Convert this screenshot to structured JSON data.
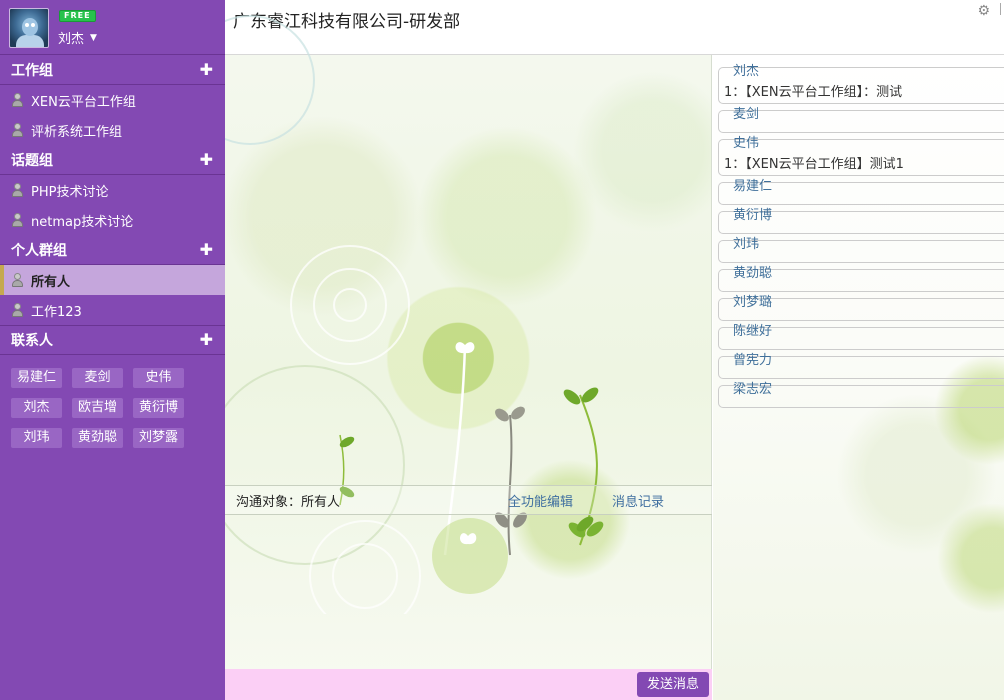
{
  "user": {
    "name": "刘杰",
    "badge": "FREE"
  },
  "groups": [
    {
      "title": "工作组",
      "items": [
        "XEN云平台工作组",
        "评析系统工作组"
      ]
    },
    {
      "title": "话题组",
      "items": [
        "PHP技术讨论",
        "netmap技术讨论"
      ]
    },
    {
      "title": "个人群组",
      "items": [
        "所有人",
        "工作123"
      ],
      "active_index": 0
    }
  ],
  "contacts": {
    "title": "联系人",
    "names": [
      "易建仁",
      "麦剑",
      "史伟",
      "刘杰",
      "欧吉增",
      "黄衍博",
      "刘玮",
      "黄劲聪",
      "刘梦露"
    ]
  },
  "header": {
    "title": "广东睿江科技有限公司-研发部"
  },
  "chat": {
    "target_label": "沟通对象：所有人",
    "full_edit": "全功能编辑",
    "history": "消息记录",
    "send_button": "发送消息"
  },
  "members": [
    {
      "name": "刘杰",
      "messages": [
        "1：【XEN云平台工作组】：测试"
      ]
    },
    {
      "name": "麦剑",
      "messages": []
    },
    {
      "name": "史伟",
      "messages": [
        "1：【XEN云平台工作组】测试1"
      ]
    },
    {
      "name": "易建仁",
      "messages": []
    },
    {
      "name": "黄衍博",
      "messages": []
    },
    {
      "name": "刘玮",
      "messages": []
    },
    {
      "name": "黄劲聪",
      "messages": []
    },
    {
      "name": "刘梦璐",
      "messages": []
    },
    {
      "name": "陈继好",
      "messages": []
    },
    {
      "name": "曾宪力",
      "messages": []
    },
    {
      "name": "梁志宏",
      "messages": []
    }
  ],
  "colors": {
    "sidebar": "#8349b3",
    "active_item": "#c5a6dc",
    "send_bar": "#fbcff5",
    "link": "#3f6fa0",
    "free_badge": "#27c24c"
  }
}
